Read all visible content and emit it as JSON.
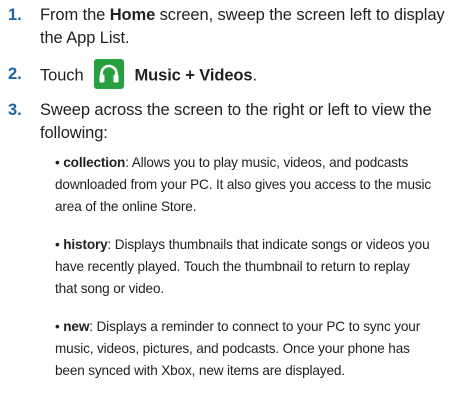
{
  "steps": [
    {
      "number": "1.",
      "line1_prefix": "From the ",
      "line1_bold": "Home",
      "line1_suffix": " screen, sweep the screen left to display",
      "line2": "the App List."
    },
    {
      "number": "2.",
      "prefix": "Touch",
      "icon": "headphones-icon",
      "bold": "Music + Videos",
      "suffix": "."
    },
    {
      "number": "3.",
      "line1": "Sweep across the screen to the right or left to view the",
      "line2": "following:"
    }
  ],
  "bullets": [
    {
      "term": "collection",
      "lines": [
        ": Allows you to play music, videos, and podcasts",
        "downloaded from your PC. It also gives you access to the music",
        "area of the online Store."
      ]
    },
    {
      "term": "history",
      "lines": [
        ": Displays thumbnails that indicate songs or videos you",
        "have recently played. Touch the thumbnail to return to replay",
        "that song or video."
      ]
    },
    {
      "term": "new",
      "lines": [
        ": Displays a reminder to connect to your PC to sync your",
        "music, videos, pictures, and podcasts. Once your phone has",
        "been synced with Xbox, new items are displayed."
      ]
    }
  ],
  "colors": {
    "step_number": "#1b62a7",
    "text": "#231f20",
    "icon_bg": "#27a13f"
  }
}
